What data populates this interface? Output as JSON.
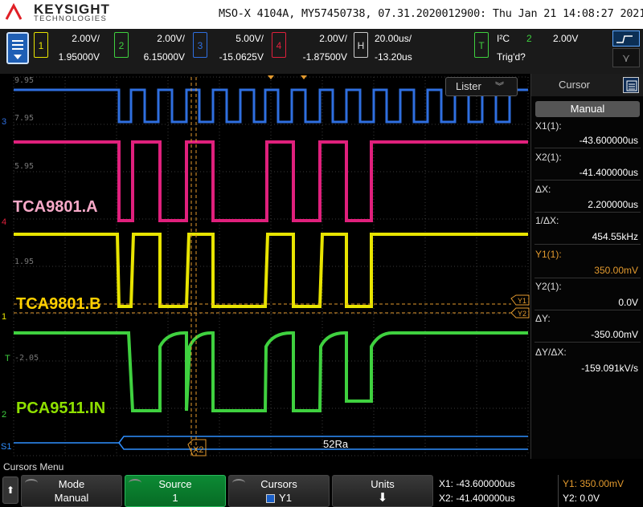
{
  "header": {
    "brand": "KEYSIGHT",
    "brand_sub": "TECHNOLOGIES",
    "info": "MSO-X 4104A, MY57450738, 07.31.2020012900: Thu Jan 21 14:08:27 2021"
  },
  "channels": [
    {
      "num": "1",
      "volts": "2.00V/",
      "offset": "1.95000V",
      "color": "#e8e400"
    },
    {
      "num": "2",
      "volts": "2.00V/",
      "offset": "6.15000V",
      "color": "#3fd13f"
    },
    {
      "num": "3",
      "volts": "5.00V/",
      "offset": "-15.0625V",
      "color": "#2f6fe0"
    },
    {
      "num": "4",
      "volts": "2.00V/",
      "offset": "-1.87500V",
      "color": "#e0203c"
    }
  ],
  "horizontal": {
    "label": "H",
    "scale": "20.00us/",
    "delay": "-13.20us"
  },
  "trigger": {
    "label": "T",
    "type": "I²C",
    "source": "2",
    "level": "2.00V",
    "status": "Trig'd?"
  },
  "scope": {
    "lister_label": "Lister",
    "grid_labels": [
      "9.95",
      "7.95",
      "5.95",
      "1.95",
      "-2.05"
    ],
    "signal_labels": {
      "a": "TCA9801.A",
      "b": "TCA9801.B",
      "in": "PCA9511.IN"
    },
    "decode_text": "52Ra",
    "cursor_x2_tag": "X2",
    "cursor_y1_tag": "Y1",
    "cursor_y2_tag": "Y2",
    "marker_labels": [
      "3",
      "4",
      "1",
      "T",
      "2",
      "S1"
    ]
  },
  "cursor_panel": {
    "title": "Cursor",
    "mode": "Manual",
    "rows": [
      {
        "label": "X1(1):",
        "value": "-43.600000us"
      },
      {
        "label": "X2(1):",
        "value": "-41.400000us"
      },
      {
        "label": "ΔX:",
        "value": "2.200000us"
      },
      {
        "label": "1/ΔX:",
        "value": "454.55kHz"
      },
      {
        "label": "Y1(1):",
        "value": "350.00mV",
        "highlight": true
      },
      {
        "label": "Y2(1):",
        "value": "0.0V"
      },
      {
        "label": "ΔY:",
        "value": "-350.00mV"
      },
      {
        "label": "ΔY/ΔX:",
        "value": "-159.091kV/s"
      }
    ]
  },
  "softkeys": {
    "menu_title": "Cursors Menu",
    "mode_label": "Mode",
    "mode_value": "Manual",
    "source_label": "Source",
    "source_value": "1",
    "cursors_label": "Cursors",
    "cursors_value": "Y1",
    "units_label": "Units"
  },
  "readout": {
    "x1": "X1: -43.600000us",
    "x2": "X2: -41.400000us",
    "y1": "Y1: 350.00mV",
    "y2": "Y2: 0.0V"
  },
  "colors": {
    "ch1": "#e8e400",
    "ch2": "#3fd13f",
    "ch3": "#2f6fe0",
    "ch4": "#e0203c",
    "cursor": "#e39a2e",
    "label_a": "#f7a9c8",
    "label_b": "#ffd000",
    "label_in": "#8fe000"
  }
}
